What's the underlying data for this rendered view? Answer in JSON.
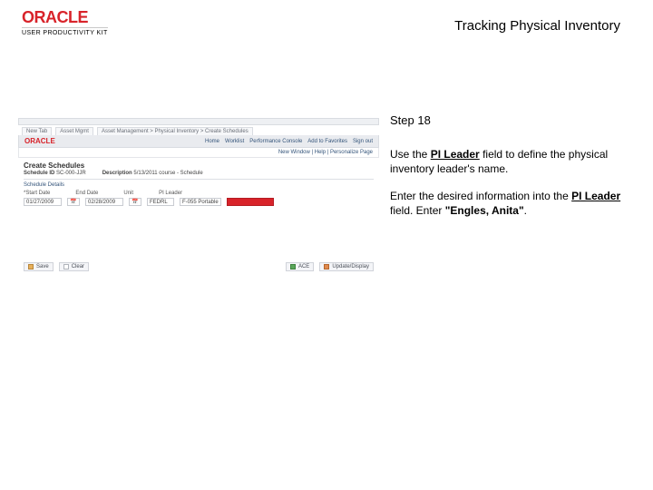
{
  "brand": {
    "name": "ORACLE",
    "sub": "USER PRODUCTIVITY KIT"
  },
  "title": "Tracking Physical Inventory",
  "panel": {
    "step": "Step 18",
    "p1a": "Use the ",
    "p1_field": "PI Leader",
    "p1b": " field to define the physical inventory leader's name.",
    "p2a": "Enter the desired information into the ",
    "p2_field": "PI Leader",
    "p2b": " field. Enter ",
    "p2_value": "\"Engles, Anita\"",
    "p2c": "."
  },
  "shot": {
    "tabs": [
      "New Tab",
      "Asset Mgmt",
      "Asset Management > Physical Inventory > Create Schedules"
    ],
    "nav": {
      "logo": "ORACLE",
      "links": [
        "Home",
        "Worklist",
        "Performance Console",
        "Add to Favorites",
        "Sign out"
      ]
    },
    "crumb": "New Window | Help | Personalize Page",
    "heading": "Create Schedules",
    "sub": {
      "left_label": "Schedule ID",
      "left_val": "SC-000-JJR",
      "right_label": "Description",
      "right_val": "5/13/2011 course - Schedule"
    },
    "section": "Schedule Details",
    "kv": {
      "start": "*Start Date",
      "end": "End Date",
      "unit_l": "Unit",
      "unit_v": "PI Leader"
    },
    "row": {
      "start": "01/27/2009",
      "cal": "📅",
      "end": "02/28/2009",
      "unit": "FEDRL",
      "code": "F-055 Portable"
    },
    "footer": {
      "save": "Save",
      "clear": "Clear",
      "ace": "ACE",
      "last": "Update/Display"
    }
  }
}
